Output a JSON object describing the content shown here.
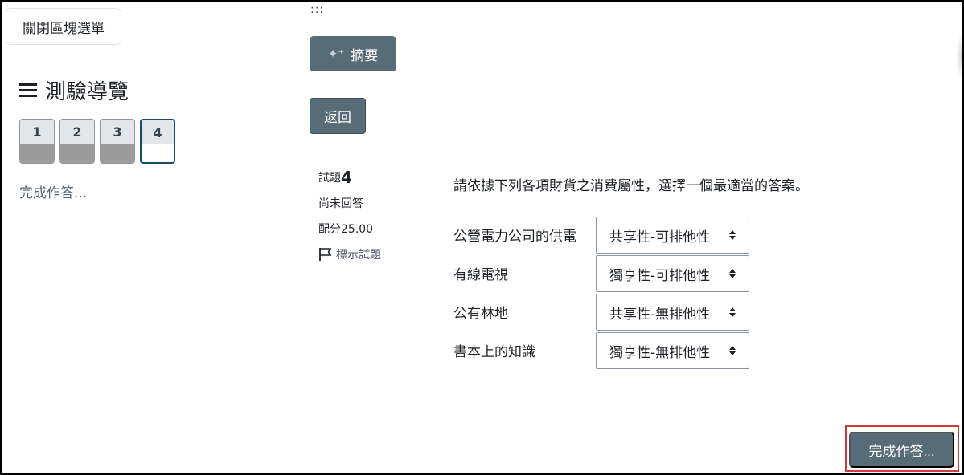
{
  "drawer": {
    "close_label": "關閉區塊選單",
    "nav_title": "測驗導覽",
    "question_numbers": [
      "1",
      "2",
      "3",
      "4"
    ],
    "finish_link": "完成作答..."
  },
  "toolbar": {
    "drag_handle": ":::",
    "summary_label": "摘要",
    "back_label": "返回"
  },
  "question": {
    "prefix": "試題",
    "number": "4",
    "state": "尚未回答",
    "mark": "配分25.00",
    "flag_label": "標示試題",
    "text": "請依據下列各項財貨之消費屬性，選擇一個最適當的答案。",
    "items": [
      {
        "label": "公營電力公司的供電",
        "selected": "共享性-可排他性"
      },
      {
        "label": "有線電視",
        "selected": "獨享性-可排他性"
      },
      {
        "label": "公有林地",
        "selected": "共享性-無排他性"
      },
      {
        "label": "書本上的知識",
        "selected": "獨享性-無排他性"
      }
    ]
  },
  "footer": {
    "finish_label": "完成作答..."
  },
  "colors": {
    "primary": "#566c76",
    "current_border": "#194d64",
    "highlight": "#d33a3a"
  }
}
